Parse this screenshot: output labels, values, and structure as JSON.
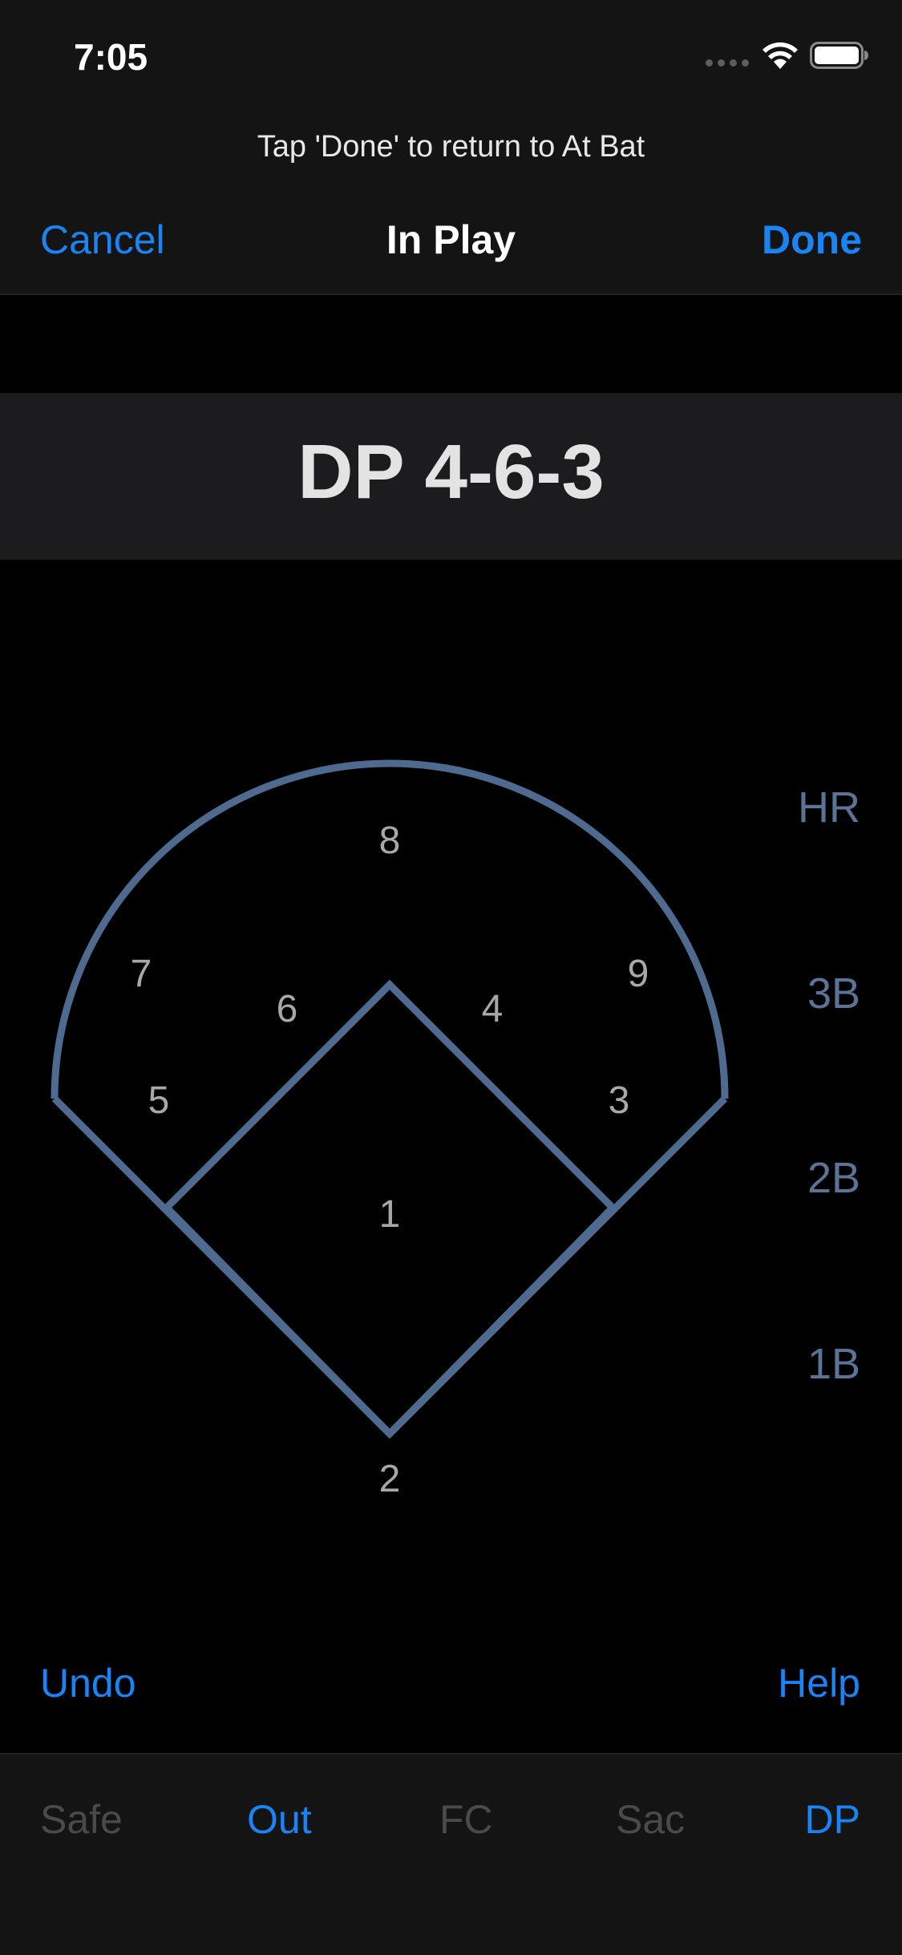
{
  "status_bar": {
    "time": "7:05"
  },
  "nav": {
    "hint": "Tap 'Done' to return to At Bat",
    "cancel_label": "Cancel",
    "title": "In Play",
    "done_label": "Done"
  },
  "result": {
    "text": "DP 4-6-3"
  },
  "field": {
    "positions": {
      "p1": "1",
      "p2": "2",
      "p3": "3",
      "p4": "4",
      "p5": "5",
      "p6": "6",
      "p7": "7",
      "p8": "8",
      "p9": "9"
    }
  },
  "hits": {
    "hr": "HR",
    "triple": "3B",
    "double": "2B",
    "single": "1B"
  },
  "actions": {
    "undo_label": "Undo",
    "help_label": "Help"
  },
  "tabs": [
    {
      "label": "Safe",
      "state": "disabled"
    },
    {
      "label": "Out",
      "state": "active"
    },
    {
      "label": "FC",
      "state": "disabled"
    },
    {
      "label": "Sac",
      "state": "disabled"
    },
    {
      "label": "DP",
      "state": "active"
    }
  ],
  "colors": {
    "accent": "#1a84f4",
    "field_line": "#4f6a8f",
    "hit_text": "#5b7396",
    "disabled": "#4a4a4a"
  }
}
